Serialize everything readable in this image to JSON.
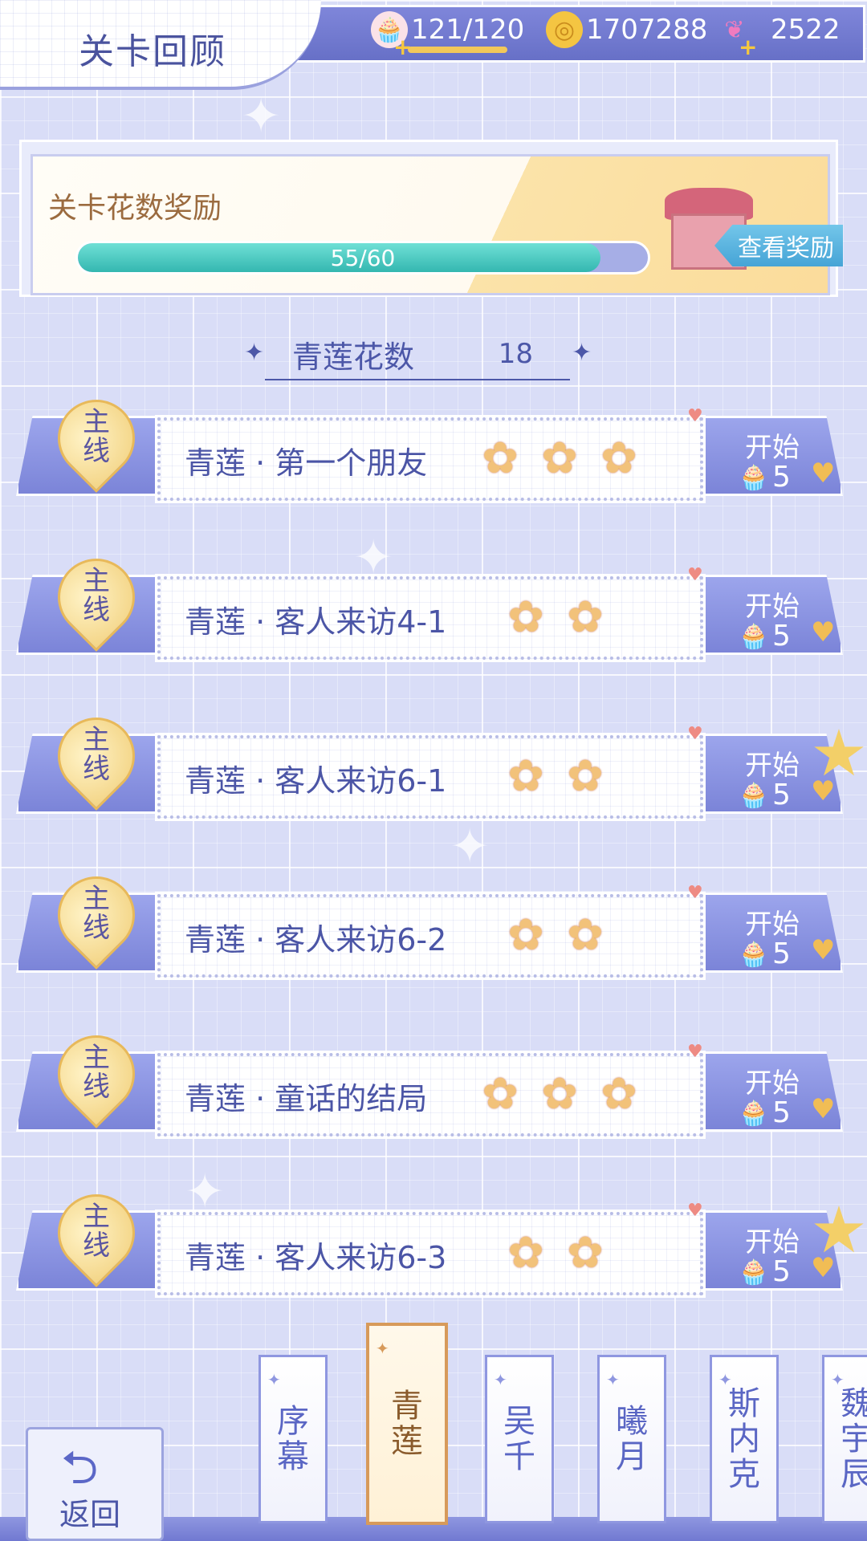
{
  "header": {
    "title": "关卡回顾",
    "stamina": "121/120",
    "coins": "1707288",
    "crystals": "2522"
  },
  "reward": {
    "title": "关卡花数奖励",
    "progress_text": "55/60",
    "progress_fraction": 0.917,
    "view_button": "查看奖励"
  },
  "flower_count": {
    "label": "青莲花数",
    "value": "18"
  },
  "levels": [
    {
      "type": "主线",
      "name": "青莲 · 第一个朋友",
      "flowers": 3,
      "start": "开始",
      "cost": "5",
      "badge": false
    },
    {
      "type": "主线",
      "name": "青莲 · 客人来访4-1",
      "flowers": 2,
      "start": "开始",
      "cost": "5",
      "badge": false
    },
    {
      "type": "主线",
      "name": "青莲 · 客人来访6-1",
      "flowers": 2,
      "start": "开始",
      "cost": "5",
      "badge": true
    },
    {
      "type": "主线",
      "name": "青莲 · 客人来访6-2",
      "flowers": 2,
      "start": "开始",
      "cost": "5",
      "badge": false
    },
    {
      "type": "主线",
      "name": "青莲 · 童话的结局",
      "flowers": 3,
      "start": "开始",
      "cost": "5",
      "badge": false
    },
    {
      "type": "主线",
      "name": "青莲 · 客人来访6-3",
      "flowers": 2,
      "start": "开始",
      "cost": "5",
      "badge": true
    }
  ],
  "tabs": [
    {
      "label": "序幕",
      "active": false
    },
    {
      "label": "青莲",
      "active": true
    },
    {
      "label": "吴千",
      "active": false
    },
    {
      "label": "曦月",
      "active": false
    },
    {
      "label": "斯内克",
      "active": false
    },
    {
      "label": "魏宇辰",
      "active": false
    }
  ],
  "back_button": "返回",
  "colors": {
    "accent": "#6770c7",
    "progress": "#34b7b0",
    "flower": "#f2c27a",
    "active_tab": "#d79a5a"
  }
}
